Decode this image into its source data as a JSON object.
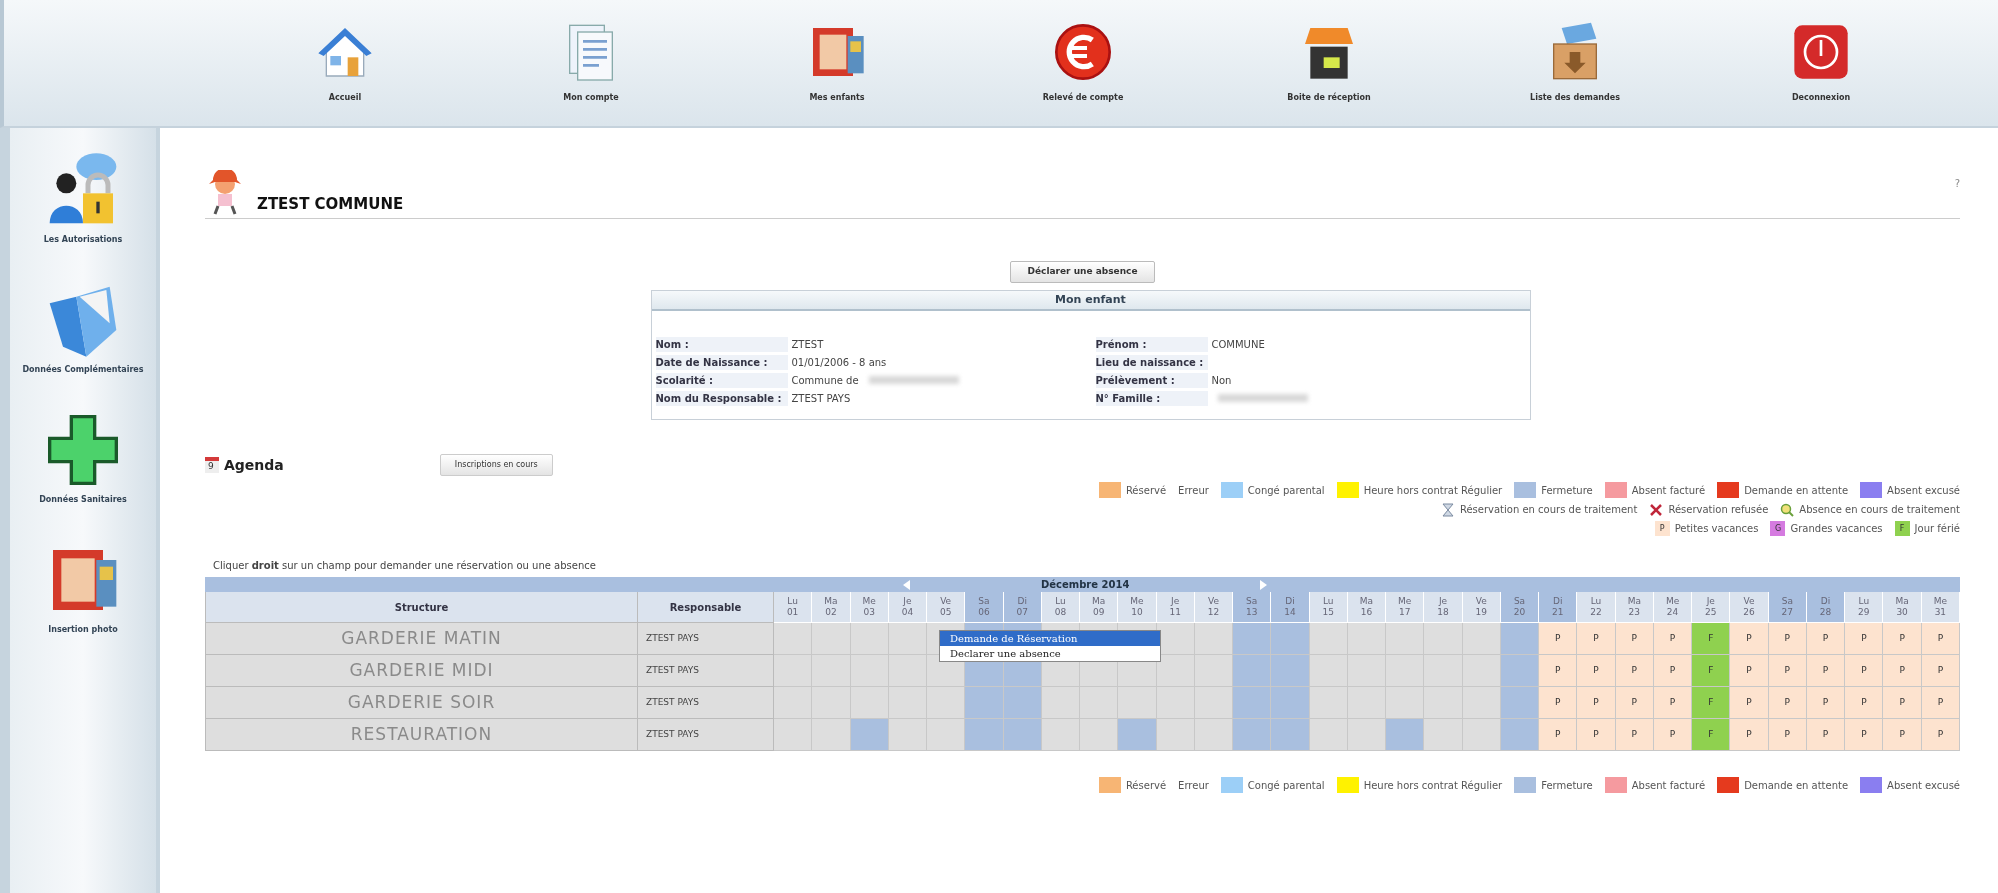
{
  "top_nav": [
    {
      "label": "Accueil",
      "kind": "house"
    },
    {
      "label": "Mon compte",
      "kind": "document"
    },
    {
      "label": "Mes enfants",
      "kind": "photo"
    },
    {
      "label": "Relevé de compte",
      "kind": "euro"
    },
    {
      "label": "Boite de réception",
      "kind": "inbox"
    },
    {
      "label": "Liste des demandes",
      "kind": "crate"
    },
    {
      "label": "Deconnexion",
      "kind": "power"
    }
  ],
  "sidebar": {
    "items": [
      {
        "label": "Les Autorisations",
        "kind": "lock"
      },
      {
        "label": "Données Complémentaires",
        "kind": "folder"
      },
      {
        "label": "Données Sanitaires",
        "kind": "cross"
      },
      {
        "label": "Insertion photo",
        "kind": "photo"
      }
    ]
  },
  "header": {
    "title": "ZTEST COMMUNE",
    "help": "?"
  },
  "absence_button": "Déclarer une absence",
  "child_panel": {
    "title": "Mon enfant",
    "left": [
      {
        "label": "Nom :",
        "value": "ZTEST",
        "redacted": false
      },
      {
        "label": "Date de Naissance :",
        "value": "01/01/2006 - 8 ans",
        "redacted": false
      },
      {
        "label": "Scolarité :",
        "value": "Commune de",
        "redacted": true
      },
      {
        "label": "Nom du Responsable :",
        "value": "ZTEST PAYS",
        "redacted": false
      }
    ],
    "right": [
      {
        "label": "Prénom :",
        "value": "COMMUNE",
        "redacted": false
      },
      {
        "label": "Lieu de naissance :",
        "redacted": false
      },
      {
        "label": "Prélèvement :",
        "value": "Non",
        "redacted": false
      },
      {
        "label": "N° Famille :",
        "redacted": true
      }
    ]
  },
  "agenda": {
    "title": "Agenda",
    "calendar_day": "9",
    "enrolments_button": "Inscriptions en cours",
    "legend": [
      [
        {
          "kind": "swatch",
          "label": "Réservé",
          "color": "#f7b574"
        },
        {
          "kind": "plain",
          "label": "Erreur"
        },
        {
          "kind": "swatch",
          "label": "Congé parental",
          "color": "#9ccff7"
        },
        {
          "kind": "swatch",
          "label": "Heure hors contrat Régulier",
          "color": "#fff200"
        },
        {
          "kind": "swatch",
          "label": "Fermeture",
          "color": "#a9bfdf"
        },
        {
          "kind": "swatch",
          "label": "Absent facturé",
          "color": "#f59a9f"
        },
        {
          "kind": "swatch",
          "label": "Demande en attente",
          "color": "#e53a1e"
        },
        {
          "kind": "swatch",
          "label": "Absent excusé",
          "color": "#8a7ef0"
        }
      ],
      [
        {
          "kind": "pending",
          "label": "Réservation en cours de traitement"
        },
        {
          "kind": "refused",
          "label": "Réservation refusée"
        },
        {
          "kind": "absence",
          "label": "Absence en cours de traitement"
        }
      ],
      [
        {
          "kind": "badge",
          "text": "P",
          "label": "Petites vacances",
          "color": "#fde3cf"
        },
        {
          "kind": "badge",
          "text": "G",
          "label": "Grandes vacances",
          "color": "#d57be0"
        },
        {
          "kind": "badge",
          "text": "F",
          "label": "Jour férié",
          "color": "#8fd14f"
        }
      ]
    ],
    "hint": "Cliquer **droit** sur un champ pour demander une réservation ou une absence",
    "calendar": {
      "month": "Décembre 2014",
      "columns": [
        "Structure",
        "Responsable"
      ],
      "days": [
        {
          "day": "Lu",
          "date": "01",
          "weekend": false
        },
        {
          "day": "Ma",
          "date": "02",
          "weekend": false
        },
        {
          "day": "Me",
          "date": "03",
          "weekend": false
        },
        {
          "day": "Je",
          "date": "04",
          "weekend": false
        },
        {
          "day": "Ve",
          "date": "05",
          "weekend": false
        },
        {
          "day": "Sa",
          "date": "06",
          "weekend": true
        },
        {
          "day": "Di",
          "date": "07",
          "weekend": true
        },
        {
          "day": "Lu",
          "date": "08",
          "weekend": false
        },
        {
          "day": "Ma",
          "date": "09",
          "weekend": false
        },
        {
          "day": "Me",
          "date": "10",
          "weekend": false
        },
        {
          "day": "Je",
          "date": "11",
          "weekend": false
        },
        {
          "day": "Ve",
          "date": "12",
          "weekend": false
        },
        {
          "day": "Sa",
          "date": "13",
          "weekend": true
        },
        {
          "day": "Di",
          "date": "14",
          "weekend": true
        },
        {
          "day": "Lu",
          "date": "15",
          "weekend": false
        },
        {
          "day": "Ma",
          "date": "16",
          "weekend": false
        },
        {
          "day": "Me",
          "date": "17",
          "weekend": false
        },
        {
          "day": "Je",
          "date": "18",
          "weekend": false
        },
        {
          "day": "Ve",
          "date": "19",
          "weekend": false
        },
        {
          "day": "Sa",
          "date": "20",
          "weekend": true
        },
        {
          "day": "Di",
          "date": "21",
          "weekend": true
        },
        {
          "day": "Lu",
          "date": "22",
          "weekend": false
        },
        {
          "day": "Ma",
          "date": "23",
          "weekend": false
        },
        {
          "day": "Me",
          "date": "24",
          "weekend": false
        },
        {
          "day": "Je",
          "date": "25",
          "weekend": false
        },
        {
          "day": "Ve",
          "date": "26",
          "weekend": false
        },
        {
          "day": "Sa",
          "date": "27",
          "weekend": true
        },
        {
          "day": "Di",
          "date": "28",
          "weekend": true
        },
        {
          "day": "Lu",
          "date": "29",
          "weekend": false
        },
        {
          "day": "Ma",
          "date": "30",
          "weekend": false
        },
        {
          "day": "Me",
          "date": "31",
          "weekend": false
        }
      ],
      "rows": [
        {
          "structure": "GARDERIE MATIN",
          "responsable": "ZTEST PAYS",
          "cells": [
            {
              "kind": "open"
            },
            {
              "kind": "open"
            },
            {
              "kind": "open"
            },
            {
              "kind": "open"
            },
            {
              "kind": "open"
            },
            {
              "kind": "closed"
            },
            {
              "kind": "closed"
            },
            {
              "kind": "open"
            },
            {
              "kind": "open"
            },
            {
              "kind": "open"
            },
            {
              "kind": "open"
            },
            {
              "kind": "open"
            },
            {
              "kind": "closed"
            },
            {
              "kind": "closed"
            },
            {
              "kind": "open"
            },
            {
              "kind": "open"
            },
            {
              "kind": "open"
            },
            {
              "kind": "open"
            },
            {
              "kind": "open"
            },
            {
              "kind": "closed"
            },
            {
              "kind": "vacation",
              "text": "P"
            },
            {
              "kind": "vacation",
              "text": "P"
            },
            {
              "kind": "vacation",
              "text": "P"
            },
            {
              "kind": "vacation",
              "text": "P"
            },
            {
              "kind": "holiday",
              "text": "F"
            },
            {
              "kind": "vacation",
              "text": "P"
            },
            {
              "kind": "vacation",
              "text": "P"
            },
            {
              "kind": "vacation",
              "text": "P"
            },
            {
              "kind": "vacation",
              "text": "P"
            },
            {
              "kind": "vacation",
              "text": "P"
            },
            {
              "kind": "vacation",
              "text": "P"
            }
          ]
        },
        {
          "structure": "GARDERIE MIDI",
          "responsable": "ZTEST PAYS",
          "cells": [
            {
              "kind": "open"
            },
            {
              "kind": "open"
            },
            {
              "kind": "open"
            },
            {
              "kind": "open"
            },
            {
              "kind": "open"
            },
            {
              "kind": "closed"
            },
            {
              "kind": "closed"
            },
            {
              "kind": "open"
            },
            {
              "kind": "open"
            },
            {
              "kind": "open"
            },
            {
              "kind": "open"
            },
            {
              "kind": "open"
            },
            {
              "kind": "closed"
            },
            {
              "kind": "closed"
            },
            {
              "kind": "open"
            },
            {
              "kind": "open"
            },
            {
              "kind": "open"
            },
            {
              "kind": "open"
            },
            {
              "kind": "open"
            },
            {
              "kind": "closed"
            },
            {
              "kind": "vacation",
              "text": "P"
            },
            {
              "kind": "vacation",
              "text": "P"
            },
            {
              "kind": "vacation",
              "text": "P"
            },
            {
              "kind": "vacation",
              "text": "P"
            },
            {
              "kind": "holiday",
              "text": "F"
            },
            {
              "kind": "vacation",
              "text": "P"
            },
            {
              "kind": "vacation",
              "text": "P"
            },
            {
              "kind": "vacation",
              "text": "P"
            },
            {
              "kind": "vacation",
              "text": "P"
            },
            {
              "kind": "vacation",
              "text": "P"
            },
            {
              "kind": "vacation",
              "text": "P"
            }
          ]
        },
        {
          "structure": "GARDERIE SOIR",
          "responsable": "ZTEST PAYS",
          "cells": [
            {
              "kind": "open"
            },
            {
              "kind": "open"
            },
            {
              "kind": "open"
            },
            {
              "kind": "open"
            },
            {
              "kind": "open"
            },
            {
              "kind": "closed"
            },
            {
              "kind": "closed"
            },
            {
              "kind": "open"
            },
            {
              "kind": "open"
            },
            {
              "kind": "open"
            },
            {
              "kind": "open"
            },
            {
              "kind": "open"
            },
            {
              "kind": "closed"
            },
            {
              "kind": "closed"
            },
            {
              "kind": "open"
            },
            {
              "kind": "open"
            },
            {
              "kind": "open"
            },
            {
              "kind": "open"
            },
            {
              "kind": "open"
            },
            {
              "kind": "closed"
            },
            {
              "kind": "vacation",
              "text": "P"
            },
            {
              "kind": "vacation",
              "text": "P"
            },
            {
              "kind": "vacation",
              "text": "P"
            },
            {
              "kind": "vacation",
              "text": "P"
            },
            {
              "kind": "holiday",
              "text": "F"
            },
            {
              "kind": "vacation",
              "text": "P"
            },
            {
              "kind": "vacation",
              "text": "P"
            },
            {
              "kind": "vacation",
              "text": "P"
            },
            {
              "kind": "vacation",
              "text": "P"
            },
            {
              "kind": "vacation",
              "text": "P"
            },
            {
              "kind": "vacation",
              "text": "P"
            }
          ]
        },
        {
          "structure": "RESTAURATION",
          "responsable": "ZTEST PAYS",
          "cells": [
            {
              "kind": "open"
            },
            {
              "kind": "open"
            },
            {
              "kind": "closed"
            },
            {
              "kind": "open"
            },
            {
              "kind": "open"
            },
            {
              "kind": "closed"
            },
            {
              "kind": "closed"
            },
            {
              "kind": "open"
            },
            {
              "kind": "open"
            },
            {
              "kind": "closed"
            },
            {
              "kind": "open"
            },
            {
              "kind": "open"
            },
            {
              "kind": "closed"
            },
            {
              "kind": "closed"
            },
            {
              "kind": "open"
            },
            {
              "kind": "open"
            },
            {
              "kind": "closed"
            },
            {
              "kind": "open"
            },
            {
              "kind": "open"
            },
            {
              "kind": "closed"
            },
            {
              "kind": "vacation",
              "text": "P"
            },
            {
              "kind": "vacation",
              "text": "P"
            },
            {
              "kind": "vacation",
              "text": "P"
            },
            {
              "kind": "vacation",
              "text": "P"
            },
            {
              "kind": "holiday",
              "text": "F"
            },
            {
              "kind": "vacation",
              "text": "P"
            },
            {
              "kind": "vacation",
              "text": "P"
            },
            {
              "kind": "vacation",
              "text": "P"
            },
            {
              "kind": "vacation",
              "text": "P"
            },
            {
              "kind": "vacation",
              "text": "P"
            },
            {
              "kind": "vacation",
              "text": "P"
            }
          ]
        }
      ],
      "context_menu": [
        {
          "label": "Demande de Réservation",
          "selected": true
        },
        {
          "label": "Declarer une absence",
          "selected": false
        }
      ]
    },
    "bottom_legend": [
      {
        "kind": "swatch",
        "label": "Réservé",
        "color": "#f7b574"
      },
      {
        "kind": "plain",
        "label": "Erreur"
      },
      {
        "kind": "swatch",
        "label": "Congé parental",
        "color": "#9ccff7"
      },
      {
        "kind": "swatch",
        "label": "Heure hors contrat Régulier",
        "color": "#fff200"
      },
      {
        "kind": "swatch",
        "label": "Fermeture",
        "color": "#a9bfdf"
      },
      {
        "kind": "swatch",
        "label": "Absent facturé",
        "color": "#f59a9f"
      },
      {
        "kind": "swatch",
        "label": "Demande en attente",
        "color": "#e53a1e"
      },
      {
        "kind": "swatch",
        "label": "Absent excusé",
        "color": "#8a7ef0"
      }
    ]
  }
}
